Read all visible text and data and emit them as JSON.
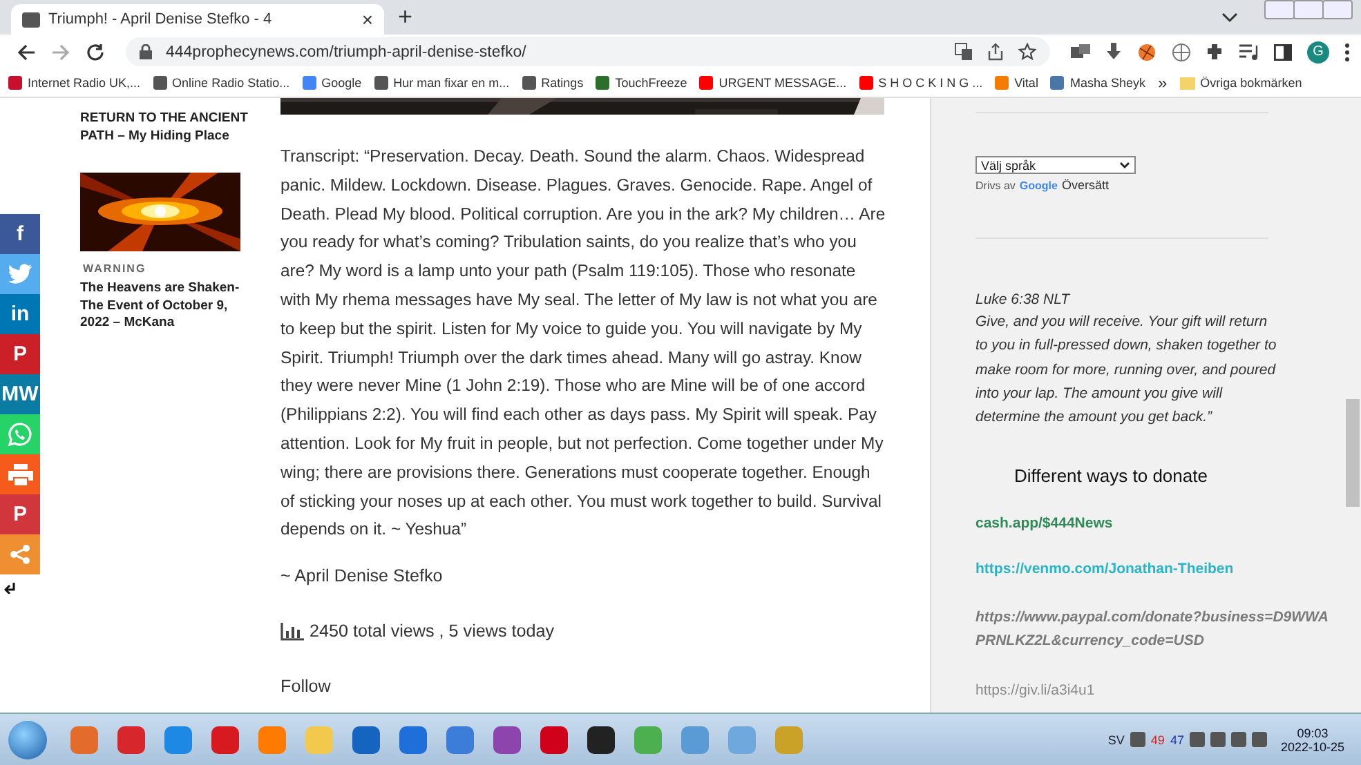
{
  "browser": {
    "tab": {
      "title": "Triumph! - April Denise Stefko - 4",
      "close": "×"
    },
    "new_tab": "+",
    "url": "444prophecynews.com/triumph-april-denise-stefko/",
    "avatar": "G",
    "bookmarks": [
      {
        "label": "Internet Radio UK,..."
      },
      {
        "label": "Online Radio Statio..."
      },
      {
        "label": "Google"
      },
      {
        "label": "Hur man fixar en m..."
      },
      {
        "label": "Ratings"
      },
      {
        "label": "TouchFreeze"
      },
      {
        "label": "URGENT MESSAGE..."
      },
      {
        "label": "S H O C K I N G ..."
      },
      {
        "label": "Vital"
      },
      {
        "label": "Masha Sheyk"
      }
    ],
    "more": "»",
    "other_bookmarks": "Övriga bokmärken"
  },
  "share_buttons": [
    {
      "kind": "glyph",
      "glyph": "f",
      "color": "#3b5998"
    },
    {
      "kind": "bird",
      "color": "#55acee"
    },
    {
      "kind": "glyph",
      "glyph": "in",
      "color": "#0077b5"
    },
    {
      "kind": "glyph",
      "glyph": "P",
      "color": "#cb2027"
    },
    {
      "kind": "glyph",
      "glyph": "MW",
      "color": "#0a7ca3"
    },
    {
      "kind": "chat",
      "color": "#25d366"
    },
    {
      "kind": "printer",
      "color": "#f65b1c"
    },
    {
      "kind": "glyph",
      "glyph": "P",
      "color": "#d0363c"
    },
    {
      "kind": "share",
      "color": "#f08e32"
    }
  ],
  "left_sidebar": {
    "post_title": "RETURN TO THE ANCIENT PATH – My Hiding Place",
    "card": {
      "category": "WARNING",
      "title": "The Heavens are Shaken-The Event of October 9, 2022 – McKana"
    }
  },
  "article": {
    "transcript": "Transcript: “Preservation. Decay. Death. Sound the alarm. Chaos. Widespread panic. Mildew. Lockdown. Disease. Plagues. Graves. Genocide. Rape. Angel of Death. Plead My blood. Political corruption. Are you in the ark? My children… Are you ready for what’s coming? Tribulation saints, do you realize that’s who you are? My word is a lamp unto your path (Psalm 119:105). Those who resonate with My rhema messages have My seal. The letter of My law is not what you are to keep but the spirit. Listen for My voice to guide you. You will navigate by My Spirit. Triumph! Triumph over the dark times ahead. Many will go astray. Know they were never Mine (1 John 2:19). Those who are Mine will be of one accord (Philippians 2:2). You will find each other as days pass. My Spirit will speak. Pay attention. Look for My fruit in people, but not perfection. Come together under My wing; there are provisions there. Generations must cooperate together. Enough of sticking your noses up at each other. You must work together to build. Survival depends on it. ~ Yeshua”",
    "signature": "~ April Denise Stefko",
    "views": "2450 total views , 5 views today",
    "follow": "Follow"
  },
  "right_sidebar": {
    "language_select": "Välj språk",
    "powered_by": "Drivs av",
    "google": "Google",
    "translate": "Översätt",
    "verse_ref": "Luke 6:38 NLT",
    "verse": "Give, and you will receive. Your gift will return to you in full-pressed down, shaken together to make room for more, running over, and poured into your lap. The amount you give will determine the amount you get back.”",
    "donate_heading": "Different ways to donate",
    "links": [
      {
        "text": "cash.app/$444News",
        "color": "#2e8b57"
      },
      {
        "text": "https://venmo.com/Jonathan-Theiben",
        "color": "#2ab5c5"
      },
      {
        "text": "https://www.paypal.com/donate?business=D9WWAPRNLKZ2L&currency_code=USD",
        "color": "#7a7a7a"
      },
      {
        "text": "https://giv.li/a3i4u1",
        "color": "#8a8a8a"
      }
    ]
  },
  "taskbar": {
    "language": "SV",
    "tray_numbers": [
      "49",
      "47"
    ],
    "time": "09:03",
    "date": "2022-10-25"
  }
}
